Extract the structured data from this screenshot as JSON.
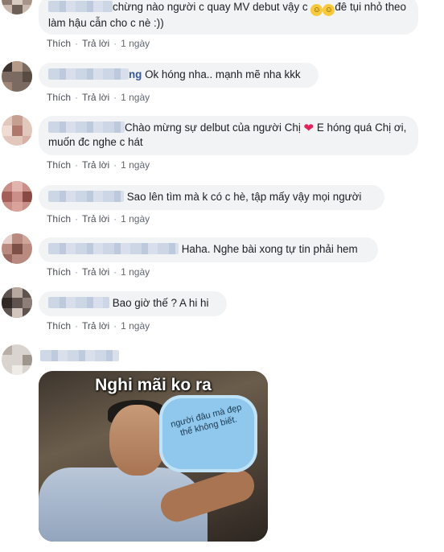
{
  "comments": [
    {
      "name_tail": "",
      "text_pre": "chừng nào người c quay MV debut vậy c",
      "text_post": "đê tụi nhỏ theo làm hậu cẫn cho c nè :))",
      "like": "Thích",
      "reply": "Trả lời",
      "time": "1 ngày"
    },
    {
      "name_tail": "ng",
      "text": "Ok hóng nha.. mạnh mẽ nha kkk",
      "like": "Thích",
      "reply": "Trả lời",
      "time": "1 ngày"
    },
    {
      "name_tail": "",
      "text_pre": "Chào mừng sự delbut của người Chị",
      "text_post": "E hóng quá Chị ơi, muốn đc nghe c hát",
      "like": "Thích",
      "reply": "Trả lời",
      "time": "1 ngày"
    },
    {
      "name_tail": "",
      "text": "Sao lên tìm mà k có c hè, tập mấy vậy mọi người",
      "like": "Thích",
      "reply": "Trả lời",
      "time": "1 ngày"
    },
    {
      "name_tail": "",
      "text": "Haha. Nghe bài xong tự tin phải hem",
      "like": "Thích",
      "reply": "Trả lời",
      "time": "1 ngày"
    },
    {
      "name_tail": "",
      "text": "Bao giờ thế ? A hi hi",
      "like": "Thích",
      "reply": "Trả lời",
      "time": "1 ngày"
    }
  ],
  "meme": {
    "title": "Nghi mãi ko ra",
    "cloud_text": "người đâu mà đẹp thế không biết."
  },
  "emoji": {
    "laugh": "😂",
    "heart": "❤"
  },
  "colors": {
    "bubble": "#f2f3f5",
    "name": "#385898",
    "meta": "#606770"
  }
}
